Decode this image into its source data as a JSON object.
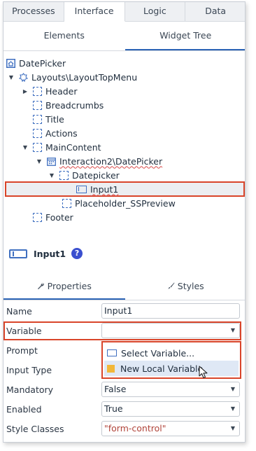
{
  "top_tabs": [
    "Processes",
    "Interface",
    "Logic",
    "Data"
  ],
  "sub_tabs": [
    "Elements",
    "Widget Tree"
  ],
  "tree": {
    "root": "DatePicker",
    "layout": "Layouts\\LayoutTopMenu",
    "header": "Header",
    "breadcrumbs": "Breadcrumbs",
    "title": "Title",
    "actions": "Actions",
    "main_content": "MainContent",
    "interaction": "Interaction2\\DatePicker",
    "datepicker": "Datepicker",
    "input1": "Input1",
    "placeholder": "Placeholder_SSPreview",
    "footer": "Footer"
  },
  "element": {
    "name": "Input1",
    "help": "?"
  },
  "prop_tabs": [
    "Properties",
    "Styles"
  ],
  "properties": {
    "name_label": "Name",
    "name_value": "Input1",
    "variable_label": "Variable",
    "variable_value": "",
    "prompt_label": "Prompt",
    "input_type_label": "Input Type",
    "mandatory_label": "Mandatory",
    "mandatory_value": "False",
    "enabled_label": "Enabled",
    "enabled_value": "True",
    "style_classes_label": "Style Classes",
    "style_classes_value": "\"form-control\""
  },
  "dropdown": {
    "select_variable": "Select Variable...",
    "new_local_variable": "New Local Variable"
  },
  "colors": {
    "accent": "#2b63b5",
    "highlight": "#d9452a",
    "icon_blue": "#3f6fc0",
    "variable_yellow": "#f2b739"
  }
}
